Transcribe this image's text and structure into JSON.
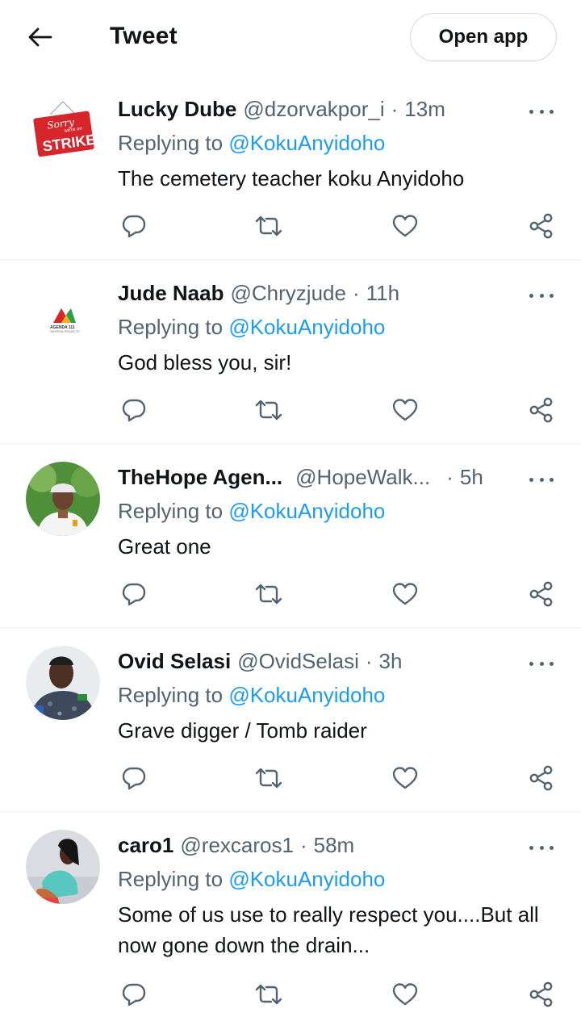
{
  "header": {
    "title": "Tweet",
    "open_app_label": "Open app"
  },
  "colors": {
    "accent": "#1d9bf0",
    "muted": "#536471",
    "text": "#0f1419",
    "border": "#cfd9de"
  },
  "tweets": [
    {
      "name": "Lucky Dube",
      "handle": "@dzorvakpor_i",
      "sep": "·",
      "time": "13m",
      "replying_label": "Replying to",
      "mention": "@KokuAnyidoho",
      "text": "The cemetery teacher koku Anyidoho",
      "avatar": {
        "line1": "Sorry",
        "line2": "we're on",
        "line3": "STRIKE"
      }
    },
    {
      "name": "Jude Naab",
      "handle": "@Chryzjude",
      "sep": "·",
      "time": "11h",
      "replying_label": "Replying to",
      "mention": "@KokuAnyidoho",
      "text": "God bless you, sir!",
      "avatar": {
        "line1": "AGENDA 111",
        "line2": "HOSPITAL PROJECTS"
      }
    },
    {
      "name": "TheHope Agen...",
      "handle": "@HopeWalk...",
      "sep": "·",
      "time": "5h",
      "replying_label": "Replying to",
      "mention": "@KokuAnyidoho",
      "text": "Great one"
    },
    {
      "name": "Ovid Selasi",
      "handle": "@OvidSelasi",
      "sep": "·",
      "time": "3h",
      "replying_label": "Replying to",
      "mention": "@KokuAnyidoho",
      "text": "Grave digger / Tomb raider"
    },
    {
      "name": "caro1",
      "handle": "@rexcaros1",
      "sep": "·",
      "time": "58m",
      "replying_label": "Replying to",
      "mention": "@KokuAnyidoho",
      "text": "Some of us use to really respect you....But all now gone down the drain..."
    }
  ]
}
